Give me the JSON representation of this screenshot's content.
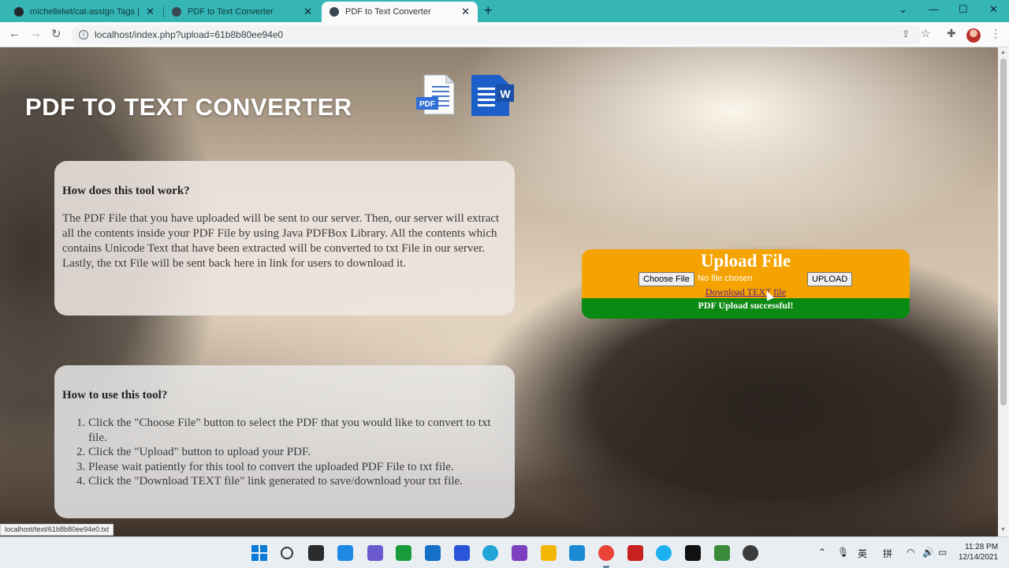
{
  "browser": {
    "tabs": [
      {
        "title": "michellelwt/cat-assign Tags | Doc",
        "active": false
      },
      {
        "title": "PDF to Text Converter",
        "active": false
      },
      {
        "title": "PDF to Text Converter",
        "active": true
      }
    ],
    "url": "localhost/index.php?upload=61b8b80ee94e0"
  },
  "page": {
    "title": "PDF TO TEXT CONVERTER",
    "how_it_works": {
      "heading": "How does this tool work?",
      "body": "The PDF File that you have uploaded will be sent to our server. Then, our server will extract all the contents inside your PDF File by using Java PDFBox Library. All the contents which contains Unicode Text that have been extracted will be converted to txt File in our server. Lastly, the txt File will be sent back here in link for users to download it."
    },
    "how_to_use": {
      "heading": "How to use this tool?",
      "steps": [
        "Click the \"Choose File\" button to select the PDF that you would like to convert to txt file.",
        "Click the \"Upload\" button to upload your PDF.",
        "Please wait patiently for this tool to convert the uploaded PDF File to txt file.",
        "Click the \"Download TEXT file\" link generated to save/download your txt file."
      ]
    },
    "upload": {
      "title": "Upload File",
      "choose_label": "Choose File",
      "no_file": "No file chosen",
      "upload_label": "UPLOAD",
      "download_link": "Download TEXT file",
      "success": "PDF Upload successful!"
    },
    "status_url": "localhost/text/61b8b80ee94e0.txt"
  },
  "taskbar": {
    "time": "11:28 PM",
    "date": "12/14/2021",
    "ime_1": "英",
    "ime_2": "拼"
  },
  "colors": {
    "tab_bar": "#35b5b5",
    "upload_orange": "#f5a300",
    "upload_green": "#0a8a12"
  }
}
